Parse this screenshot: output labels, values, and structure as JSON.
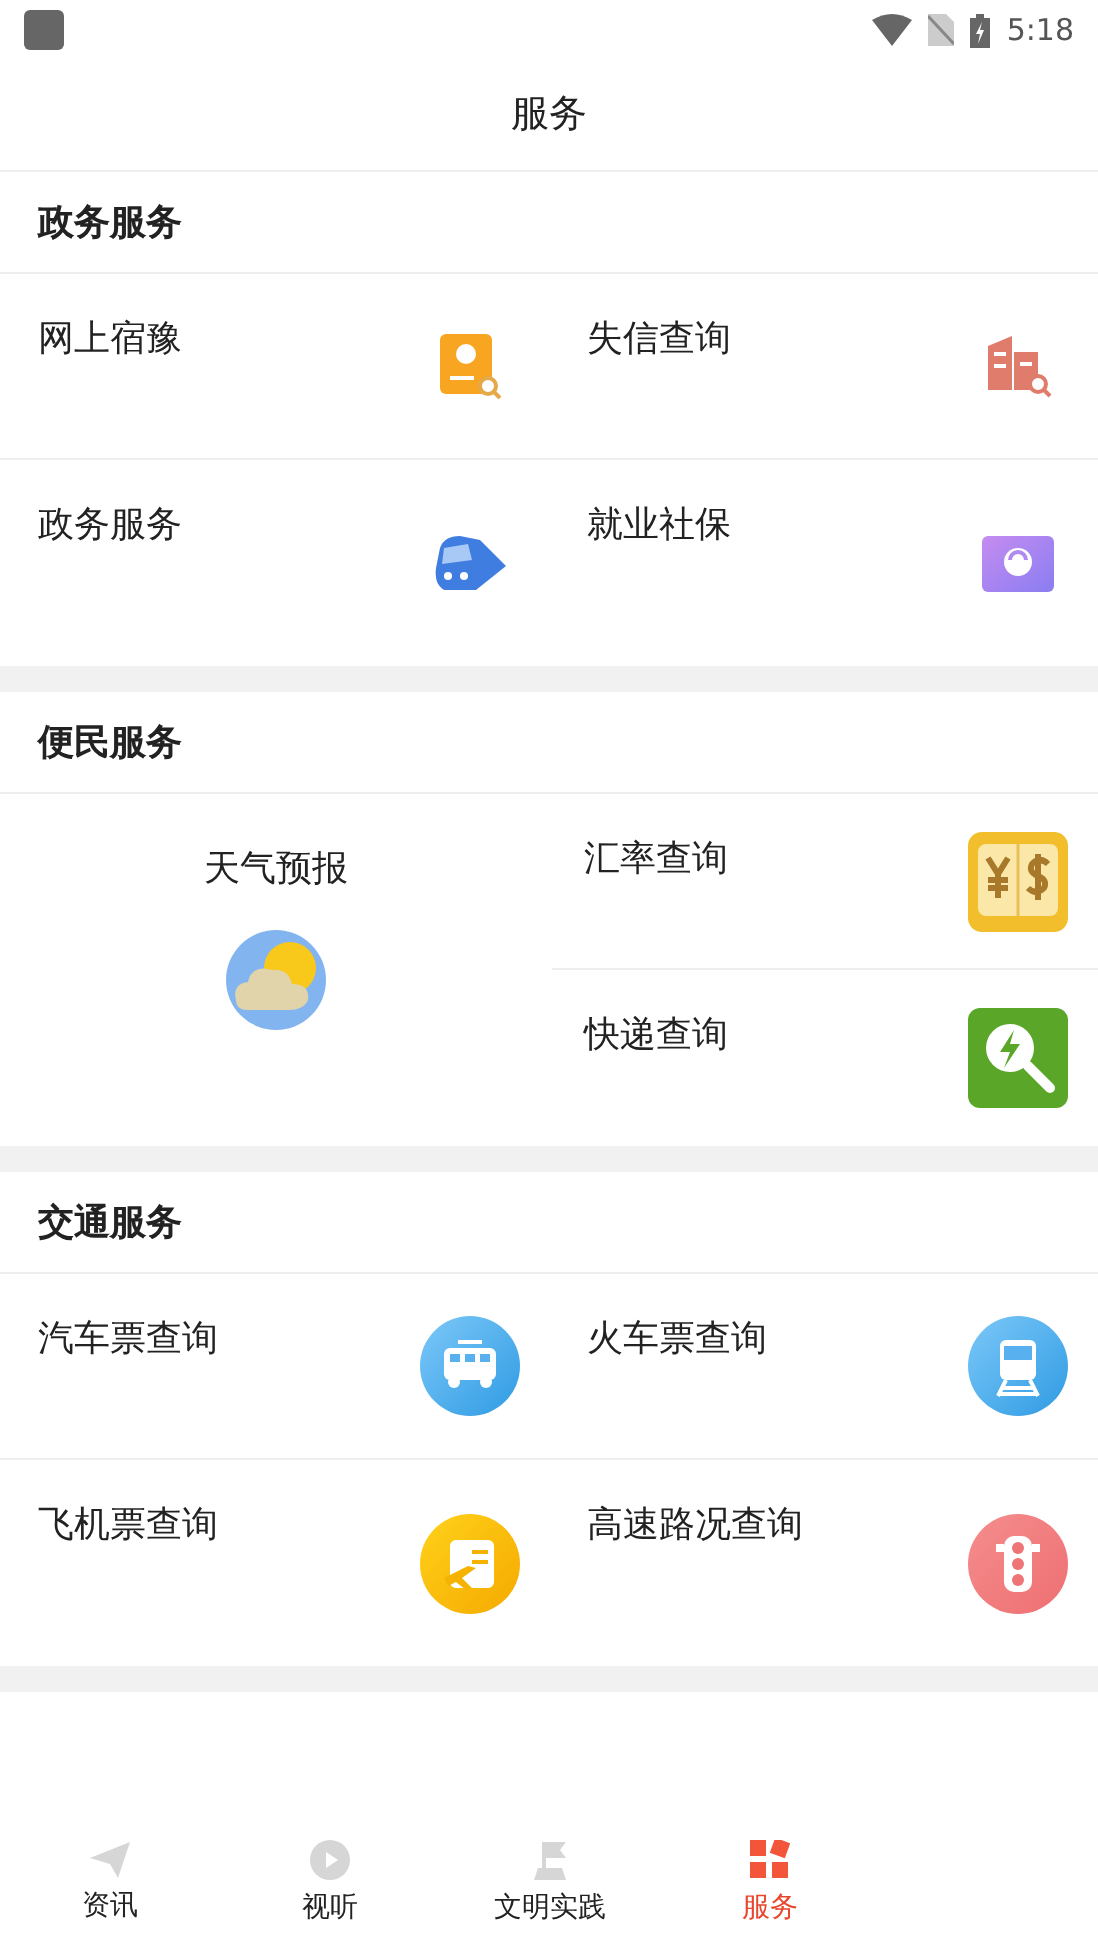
{
  "status_bar": {
    "time": "5:18"
  },
  "title": "服务",
  "sections": [
    {
      "title": "政务服务",
      "kind": "grid",
      "items": [
        {
          "label": "网上宿豫"
        },
        {
          "label": "失信查询"
        },
        {
          "label": "政务服务"
        },
        {
          "label": "就业社保"
        }
      ]
    },
    {
      "title": "便民服务",
      "kind": "feature",
      "items": [
        {
          "label": "天气预报"
        },
        {
          "label": "汇率查询"
        },
        {
          "label": "快递查询"
        }
      ]
    },
    {
      "title": "交通服务",
      "kind": "grid",
      "items": [
        {
          "label": "汽车票查询"
        },
        {
          "label": "火车票查询"
        },
        {
          "label": "飞机票查询"
        },
        {
          "label": "高速路况查询"
        }
      ]
    }
  ],
  "tabs": [
    {
      "label": "资讯",
      "selected": false
    },
    {
      "label": "视听",
      "selected": false
    },
    {
      "label": "文明实践",
      "selected": false
    },
    {
      "label": "服务",
      "selected": true
    }
  ]
}
